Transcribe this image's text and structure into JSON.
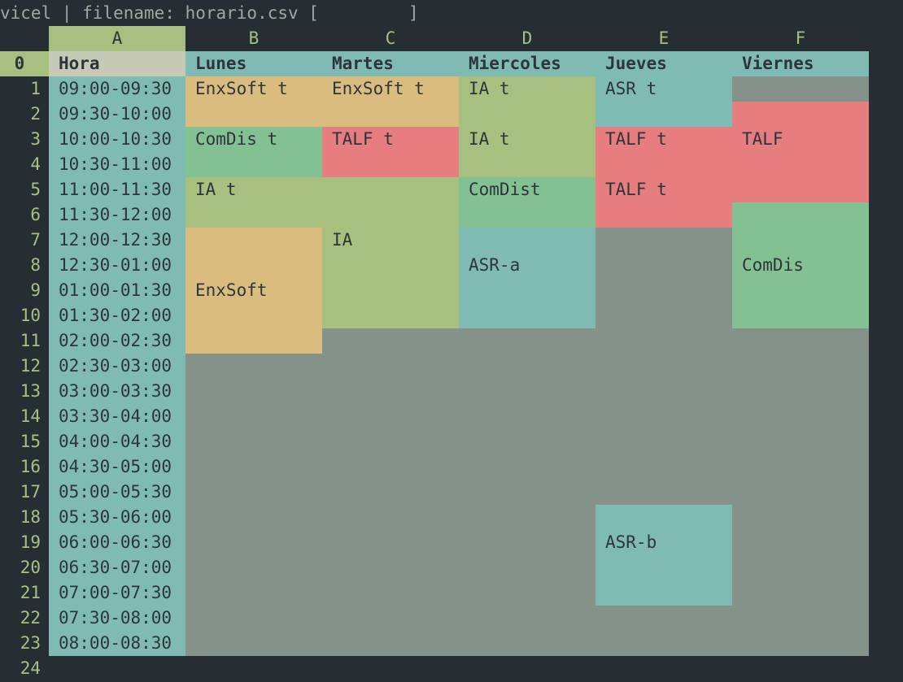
{
  "status": {
    "prefix": "vicel | filename: horario.csv [",
    "input": "",
    "suffix": "]"
  },
  "columns": [
    "A",
    "B",
    "C",
    "D",
    "E",
    "F"
  ],
  "rows": [
    "0",
    "1",
    "2",
    "3",
    "4",
    "5",
    "6",
    "7",
    "8",
    "9",
    "10",
    "11",
    "12",
    "13",
    "14",
    "15",
    "16",
    "17",
    "18",
    "19",
    "20",
    "21",
    "22",
    "23",
    "24"
  ],
  "colors": {
    "background": "#272e33",
    "header_green": "#a7c080",
    "teal": "#7fbbb3",
    "orange": "#dbbc7f",
    "green": "#a7c080",
    "mint": "#83c092",
    "red": "#e67e80",
    "grey": "#859289",
    "selected_cell": "#c5c9b5"
  },
  "headers": {
    "hora": "Hora",
    "lunes": "Lunes",
    "martes": "Martes",
    "miercoles": "Miercoles",
    "jueves": "Jueves",
    "viernes": "Viernes"
  },
  "hours": [
    "09:00-09:30",
    "09:30-10:00",
    "10:00-10:30",
    "10:30-11:00",
    "11:00-11:30",
    "11:30-12:00",
    "12:00-12:30",
    "12:30-01:00",
    "01:00-01:30",
    "01:30-02:00",
    "02:00-02:30",
    "02:30-03:00",
    "03:00-03:30",
    "03:30-04:00",
    "04:00-04:30",
    "04:30-05:00",
    "05:00-05:30",
    "05:30-06:00",
    "06:00-06:30",
    "06:30-07:00",
    "07:00-07:30",
    "07:30-08:00",
    "08:00-08:30"
  ],
  "classes": {
    "b1": "EnxSoft t",
    "c1": "EnxSoft t",
    "d1": "IA t",
    "e1": "ASR t",
    "b3": "ComDis t",
    "c3": "TALF t",
    "d3": "IA t",
    "e3": "TALF t",
    "f3": "TALF",
    "b5": "IA t",
    "d5": "ComDist",
    "e5": "TALF t",
    "c7": "IA",
    "d8": "ASR-a",
    "f8": "ComDis",
    "b9": "EnxSoft",
    "e19": "ASR-b"
  }
}
